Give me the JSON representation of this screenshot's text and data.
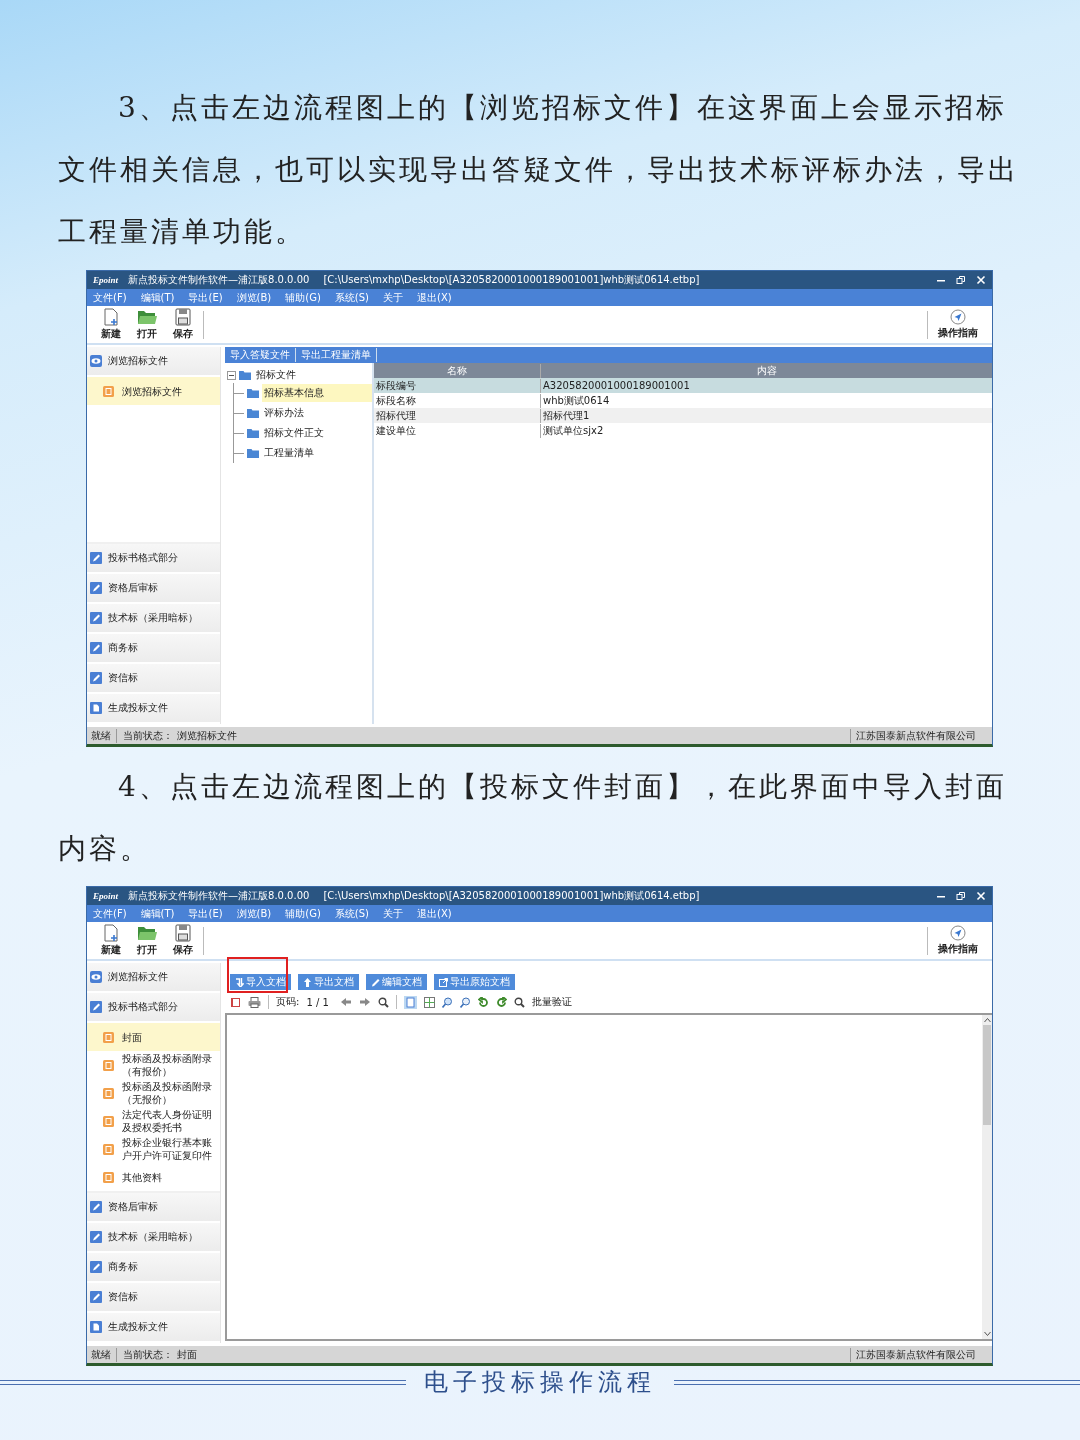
{
  "sections": [
    {
      "paragraph": "3、点击左边流程图上的【浏览招标文件】在这界面上会显示招标文件相关信息，也可以实现导出答疑文件，导出技术标评标办法，导出工程量清单功能。",
      "window": {
        "logo": "Epoint",
        "title": "新点投标文件制作软件—浦江版8.0.0.00",
        "path": "[C:\\Users\\mxhp\\Desktop\\[A3205820001000189001001]whb测试0614.etbp]",
        "menu": [
          "文件(F)",
          "编辑(T)",
          "导出(E)",
          "浏览(B)",
          "辅助(G)",
          "系统(S)",
          "关于",
          "退出(X)"
        ],
        "tools": [
          "新建",
          "打开",
          "保存"
        ],
        "guide": "操作指南",
        "sidebar": [
          {
            "kind": "browse",
            "label": "浏览招标文件",
            "children": [
              {
                "label": "浏览招标文件",
                "selected": true
              }
            ]
          },
          {
            "kind": "edit",
            "label": "投标书格式部分"
          },
          {
            "kind": "edit",
            "label": "资格后审标"
          },
          {
            "kind": "edit",
            "label": "技术标（采用暗标）"
          },
          {
            "kind": "edit",
            "label": "商务标"
          },
          {
            "kind": "edit",
            "label": "资信标"
          },
          {
            "kind": "generate",
            "label": "生成投标文件"
          }
        ],
        "main": {
          "kind": "browse",
          "actions": [
            {
              "label": "导入答疑文件"
            },
            {
              "label": "导出工程量清单"
            }
          ],
          "tree": {
            "label": "招标文件",
            "expanded": true,
            "children": [
              {
                "label": "招标基本信息",
                "selected": true
              },
              {
                "label": "评标办法",
                "selected": false
              },
              {
                "label": "招标文件正文",
                "selected": false
              },
              {
                "label": "工程量清单",
                "selected": false
              }
            ]
          },
          "table": {
            "columns": [
              "名称",
              "内容"
            ],
            "rows": [
              {
                "cells": [
                  "标段编号",
                  "A3205820001000189001001"
                ],
                "selected": true
              },
              {
                "cells": [
                  "标段名称",
                  "whb测试0614"
                ],
                "selected": false
              },
              {
                "cells": [
                  "招标代理",
                  "招标代理1"
                ],
                "selected": false
              },
              {
                "cells": [
                  "建设单位",
                  "测试单位sjx2"
                ],
                "selected": false
              }
            ]
          }
        },
        "status": {
          "ready": "就绪",
          "state_label": "当前状态：",
          "state_value": "浏览招标文件",
          "company": "江苏国泰新点软件有限公司"
        }
      }
    },
    {
      "paragraph": "4、点击左边流程图上的【投标文件封面】，在此界面中导入封面内容。",
      "window": {
        "logo": "Epoint",
        "title": "新点投标文件制作软件—浦江版8.0.0.00",
        "path": "[C:\\Users\\mxhp\\Desktop\\[A3205820001000189001001]whb测试0614.etbp]",
        "menu": [
          "文件(F)",
          "编辑(T)",
          "导出(E)",
          "浏览(B)",
          "辅助(G)",
          "系统(S)",
          "关于",
          "退出(X)"
        ],
        "tools": [
          "新建",
          "打开",
          "保存"
        ],
        "guide": "操作指南",
        "sidebar": [
          {
            "kind": "browse",
            "label": "浏览招标文件"
          },
          {
            "kind": "edit",
            "label": "投标书格式部分",
            "children": [
              {
                "label": "封面",
                "selected": true
              },
              {
                "label": "投标函及投标函附录（有报价）",
                "selected": false
              },
              {
                "label": "投标函及投标函附录（无报价）",
                "selected": false
              },
              {
                "label": "法定代表人身份证明及授权委托书",
                "selected": false
              },
              {
                "label": "投标企业银行基本账户开户许可证复印件",
                "selected": false
              },
              {
                "label": "其他资料",
                "selected": false
              }
            ]
          },
          {
            "kind": "edit",
            "label": "资格后审标"
          },
          {
            "kind": "edit",
            "label": "技术标（采用暗标）"
          },
          {
            "kind": "edit",
            "label": "商务标"
          },
          {
            "kind": "edit",
            "label": "资信标"
          },
          {
            "kind": "generate",
            "label": "生成投标文件"
          }
        ],
        "main": {
          "kind": "document",
          "actions": [
            {
              "label": "导入文档",
              "highlighted": true
            },
            {
              "label": "导出文档",
              "highlighted": false
            },
            {
              "label": "编辑文档",
              "highlighted": false
            },
            {
              "label": "导出原始文档",
              "highlighted": false
            }
          ],
          "viewer": {
            "page_label": "页码:",
            "page_value": "1 / 1",
            "verify_label": "批量验证"
          }
        },
        "status": {
          "ready": "就绪",
          "state_label": "当前状态：",
          "state_value": "封面",
          "company": "江苏国泰新点软件有限公司"
        }
      }
    }
  ],
  "footer": "电子投标操作流程"
}
